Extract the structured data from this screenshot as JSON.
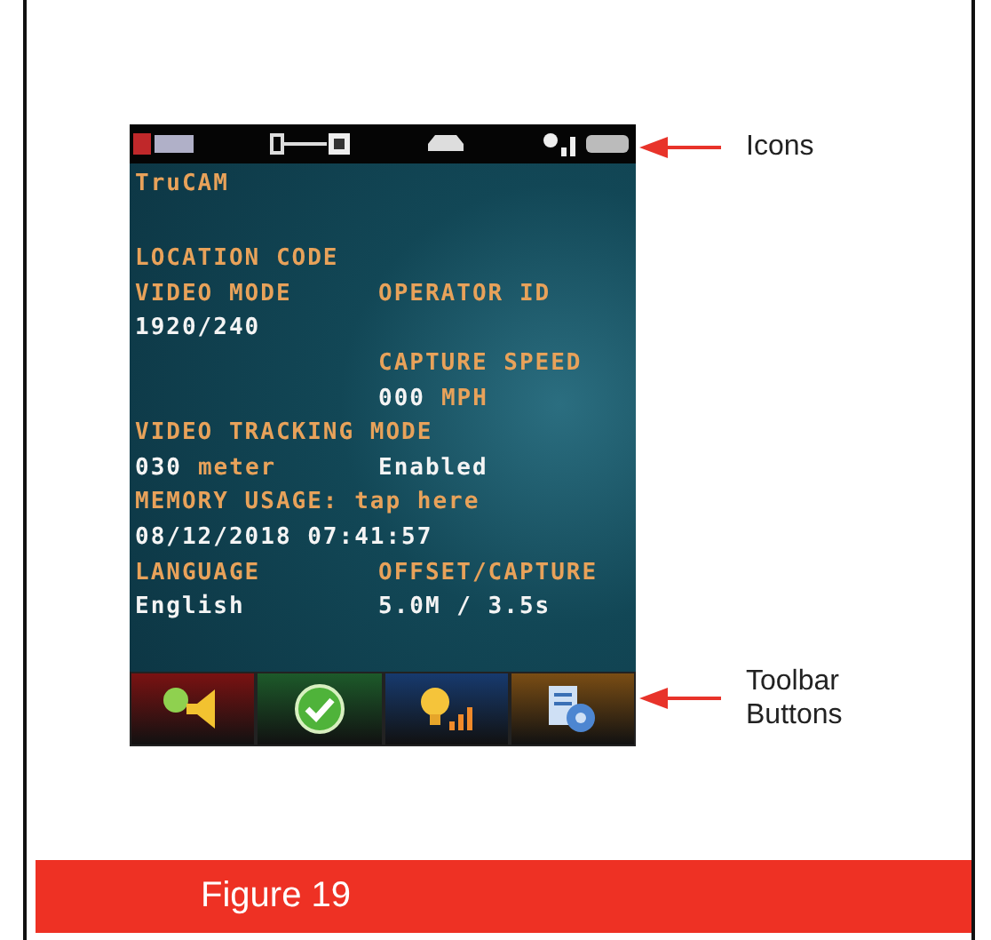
{
  "screen": {
    "title": "TruCAM",
    "rows": [
      {
        "left": [
          {
            "text": "LOCATION CODE",
            "kind": "label"
          }
        ],
        "right": []
      },
      {
        "left": [
          {
            "text": "VIDEO MODE",
            "kind": "label"
          }
        ],
        "right": [
          {
            "text": "OPERATOR ID",
            "kind": "label"
          }
        ]
      },
      {
        "left": [
          {
            "text": "1920/240",
            "kind": "value"
          }
        ],
        "right": []
      },
      {
        "left": [],
        "right": [
          {
            "text": "CAPTURE SPEED",
            "kind": "label"
          }
        ]
      },
      {
        "left": [],
        "right": [
          {
            "text": "000",
            "kind": "value"
          },
          {
            "text": "MPH",
            "kind": "label"
          }
        ]
      },
      {
        "left": [
          {
            "text": "VIDEO TRACKING MODE",
            "kind": "label"
          }
        ],
        "right": []
      },
      {
        "left": [
          {
            "text": "030",
            "kind": "value"
          },
          {
            "text": "meter",
            "kind": "label"
          }
        ],
        "right": [
          {
            "text": "Enabled",
            "kind": "value"
          }
        ]
      },
      {
        "left": [
          {
            "text": "MEMORY USAGE: tap here",
            "kind": "label"
          }
        ],
        "right": []
      },
      {
        "left": [
          {
            "text": "08/12/2018 07:41:57",
            "kind": "value"
          }
        ],
        "right": []
      },
      {
        "left": [
          {
            "text": "LANGUAGE",
            "kind": "label"
          }
        ],
        "right": [
          {
            "text": "OFFSET/CAPTURE",
            "kind": "label"
          }
        ]
      },
      {
        "left": [
          {
            "text": "English",
            "kind": "value"
          }
        ],
        "right": [
          {
            "text": "5.0M / 3.5s",
            "kind": "value"
          }
        ]
      }
    ],
    "toolbar": [
      {
        "kind": "speaker",
        "color": "#7a1212"
      },
      {
        "kind": "check",
        "color": "#1d5a2a"
      },
      {
        "kind": "bulb",
        "color": "#173a6e"
      },
      {
        "kind": "document",
        "color": "#7a4d14"
      }
    ]
  },
  "annotations": [
    {
      "text": "Icons"
    },
    {
      "text": "Toolbar Buttons"
    }
  ],
  "caption": "Figure 19"
}
